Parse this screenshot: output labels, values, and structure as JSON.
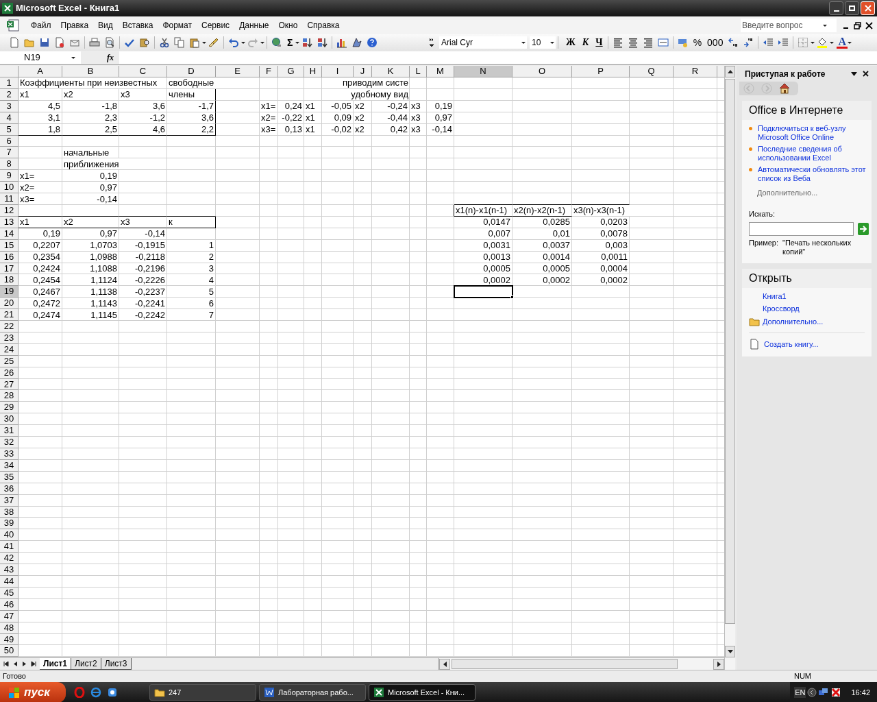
{
  "window": {
    "title": "Microsoft Excel - Книга1"
  },
  "menu": [
    "Файл",
    "Правка",
    "Вид",
    "Вставка",
    "Формат",
    "Сервис",
    "Данные",
    "Окно",
    "Справка"
  ],
  "help_search": {
    "placeholder": "Введите вопрос"
  },
  "toolbar": {
    "autosum": "Σ",
    "font": "Arial Cyr",
    "font_size": "10",
    "bold": "Ж",
    "italic": "К",
    "underline": "Ч",
    "percent": "%",
    "thousands": "000",
    "font_color": "A"
  },
  "formula_bar": {
    "name_box": "N19",
    "fx": "fx"
  },
  "sheet": {
    "columns": [
      {
        "label": "A",
        "selected": false
      },
      {
        "label": "B",
        "selected": false
      },
      {
        "label": "C",
        "selected": false
      },
      {
        "label": "D",
        "selected": false
      },
      {
        "label": "E",
        "selected": false
      },
      {
        "label": "F",
        "selected": false
      },
      {
        "label": "G",
        "selected": false
      },
      {
        "label": "H",
        "selected": false
      },
      {
        "label": "I",
        "selected": false
      },
      {
        "label": "J",
        "selected": false
      },
      {
        "label": "K",
        "selected": false
      },
      {
        "label": "L",
        "selected": false
      },
      {
        "label": "M",
        "selected": false
      },
      {
        "label": "N",
        "selected": true
      },
      {
        "label": "O",
        "selected": false
      },
      {
        "label": "P",
        "selected": false
      },
      {
        "label": "Q",
        "selected": false
      },
      {
        "label": "R",
        "selected": false
      }
    ],
    "rows": [
      {
        "header": "1",
        "selected": false,
        "cells": [
          {
            "text": "Коэффициенты при неизвестных",
            "kind": "text"
          },
          null,
          null,
          {
            "text": "свободные",
            "kind": "text"
          },
          null,
          null,
          null,
          null,
          null,
          null,
          {
            "text": "приводим систе",
            "kind": "clipped"
          }
        ]
      },
      {
        "header": "2",
        "selected": false,
        "cells": [
          {
            "text": "x1",
            "kind": "text"
          },
          {
            "text": "x2",
            "kind": "text"
          },
          {
            "text": "x3",
            "kind": "text"
          },
          {
            "text": "члены",
            "kind": "text"
          },
          null,
          null,
          null,
          null,
          null,
          null,
          {
            "text": "удобному вид",
            "kind": "clipped"
          }
        ]
      },
      {
        "header": "3",
        "selected": false,
        "cells": [
          {
            "text": "4,5",
            "kind": "number"
          },
          {
            "text": "-1,8",
            "kind": "number"
          },
          {
            "text": "3,6",
            "kind": "number"
          },
          {
            "text": "-1,7",
            "kind": "number"
          },
          null,
          {
            "text": "x1=",
            "kind": "text"
          },
          {
            "text": "0,24",
            "kind": "number"
          },
          {
            "text": "x1",
            "kind": "text"
          },
          {
            "text": "-0,05",
            "kind": "number"
          },
          {
            "text": "x2",
            "kind": "text"
          },
          {
            "text": "-0,24",
            "kind": "number"
          },
          {
            "text": "x3",
            "kind": "text"
          },
          {
            "text": "0,19",
            "kind": "number"
          }
        ]
      },
      {
        "header": "4",
        "selected": false,
        "cells": [
          {
            "text": "3,1",
            "kind": "number"
          },
          {
            "text": "2,3",
            "kind": "number"
          },
          {
            "text": "-1,2",
            "kind": "number"
          },
          {
            "text": "3,6",
            "kind": "number"
          },
          null,
          {
            "text": "x2=",
            "kind": "text"
          },
          {
            "text": "-0,22",
            "kind": "number"
          },
          {
            "text": "x1",
            "kind": "text"
          },
          {
            "text": "0,09",
            "kind": "number"
          },
          {
            "text": "x2",
            "kind": "text"
          },
          {
            "text": "-0,44",
            "kind": "number"
          },
          {
            "text": "x3",
            "kind": "text"
          },
          {
            "text": "0,97",
            "kind": "number"
          }
        ]
      },
      {
        "header": "5",
        "selected": false,
        "cells": [
          {
            "text": "1,8",
            "kind": "number"
          },
          {
            "text": "2,5",
            "kind": "number"
          },
          {
            "text": "4,6",
            "kind": "number"
          },
          {
            "text": "2,2",
            "kind": "number"
          },
          null,
          {
            "text": "x3=",
            "kind": "text"
          },
          {
            "text": "0,13",
            "kind": "number"
          },
          {
            "text": "x1",
            "kind": "text"
          },
          {
            "text": "-0,02",
            "kind": "number"
          },
          {
            "text": "x2",
            "kind": "text"
          },
          {
            "text": "0,42",
            "kind": "number"
          },
          {
            "text": "x3",
            "kind": "text"
          },
          {
            "text": "-0,14",
            "kind": "number"
          }
        ]
      },
      {
        "header": "6",
        "selected": false
      },
      {
        "header": "7",
        "selected": false,
        "cells": [
          null,
          {
            "text": "начальные",
            "kind": "text"
          }
        ]
      },
      {
        "header": "8",
        "selected": false,
        "cells": [
          null,
          {
            "text": "приближения",
            "kind": "text"
          }
        ]
      },
      {
        "header": "9",
        "selected": false,
        "cells": [
          {
            "text": "x1=",
            "kind": "text"
          },
          {
            "text": "0,19",
            "kind": "number"
          }
        ]
      },
      {
        "header": "10",
        "selected": false,
        "cells": [
          {
            "text": "x2=",
            "kind": "text"
          },
          {
            "text": "0,97",
            "kind": "number"
          }
        ]
      },
      {
        "header": "11",
        "selected": false,
        "cells": [
          {
            "text": "x3=",
            "kind": "text"
          },
          {
            "text": "-0,14",
            "kind": "number"
          }
        ]
      },
      {
        "header": "12",
        "selected": false,
        "cells": [
          null,
          null,
          null,
          null,
          null,
          null,
          null,
          null,
          null,
          null,
          null,
          null,
          null,
          {
            "text": "x1(n)-x1(n-1)",
            "kind": "text"
          },
          {
            "text": "x2(n)-x2(n-1)",
            "kind": "text"
          },
          {
            "text": "x3(n)-x3(n-1)",
            "kind": "text"
          }
        ]
      },
      {
        "header": "13",
        "selected": false,
        "cells": [
          {
            "text": "x1",
            "kind": "text"
          },
          {
            "text": "x2",
            "kind": "text"
          },
          {
            "text": "x3",
            "kind": "text"
          },
          {
            "text": "к",
            "kind": "text"
          },
          null,
          null,
          null,
          null,
          null,
          null,
          null,
          null,
          null,
          {
            "text": "0,0147",
            "kind": "number"
          },
          {
            "text": "0,0285",
            "kind": "number"
          },
          {
            "text": "0,0203",
            "kind": "number"
          }
        ]
      },
      {
        "header": "14",
        "selected": false,
        "cells": [
          {
            "text": "0,19",
            "kind": "number"
          },
          {
            "text": "0,97",
            "kind": "number"
          },
          {
            "text": "-0,14",
            "kind": "number"
          },
          null,
          null,
          null,
          null,
          null,
          null,
          null,
          null,
          null,
          null,
          {
            "text": "0,007",
            "kind": "number"
          },
          {
            "text": "0,01",
            "kind": "number"
          },
          {
            "text": "0,0078",
            "kind": "number"
          }
        ]
      },
      {
        "header": "15",
        "selected": false,
        "cells": [
          {
            "text": "0,2207",
            "kind": "number"
          },
          {
            "text": "1,0703",
            "kind": "number"
          },
          {
            "text": "-0,1915",
            "kind": "number"
          },
          {
            "text": "1",
            "kind": "number"
          },
          null,
          null,
          null,
          null,
          null,
          null,
          null,
          null,
          null,
          {
            "text": "0,0031",
            "kind": "number"
          },
          {
            "text": "0,0037",
            "kind": "number"
          },
          {
            "text": "0,003",
            "kind": "number"
          }
        ]
      },
      {
        "header": "16",
        "selected": false,
        "cells": [
          {
            "text": "0,2354",
            "kind": "number"
          },
          {
            "text": "1,0988",
            "kind": "number"
          },
          {
            "text": "-0,2118",
            "kind": "number"
          },
          {
            "text": "2",
            "kind": "number"
          },
          null,
          null,
          null,
          null,
          null,
          null,
          null,
          null,
          null,
          {
            "text": "0,0013",
            "kind": "number"
          },
          {
            "text": "0,0014",
            "kind": "number"
          },
          {
            "text": "0,0011",
            "kind": "number"
          }
        ]
      },
      {
        "header": "17",
        "selected": false,
        "cells": [
          {
            "text": "0,2424",
            "kind": "number"
          },
          {
            "text": "1,1088",
            "kind": "number"
          },
          {
            "text": "-0,2196",
            "kind": "number"
          },
          {
            "text": "3",
            "kind": "number"
          },
          null,
          null,
          null,
          null,
          null,
          null,
          null,
          null,
          null,
          {
            "text": "0,0005",
            "kind": "number"
          },
          {
            "text": "0,0005",
            "kind": "number"
          },
          {
            "text": "0,0004",
            "kind": "number"
          }
        ]
      },
      {
        "header": "18",
        "selected": false,
        "cells": [
          {
            "text": "0,2454",
            "kind": "number"
          },
          {
            "text": "1,1124",
            "kind": "number"
          },
          {
            "text": "-0,2226",
            "kind": "number"
          },
          {
            "text": "4",
            "kind": "number"
          },
          null,
          null,
          null,
          null,
          null,
          null,
          null,
          null,
          null,
          {
            "text": "0,0002",
            "kind": "number"
          },
          {
            "text": "0,0002",
            "kind": "number"
          },
          {
            "text": "0,0002",
            "kind": "number"
          }
        ]
      },
      {
        "header": "19",
        "selected": true,
        "cells": [
          {
            "text": "0,2467",
            "kind": "number"
          },
          {
            "text": "1,1138",
            "kind": "number"
          },
          {
            "text": "-0,2237",
            "kind": "number"
          },
          {
            "text": "5",
            "kind": "number"
          }
        ]
      },
      {
        "header": "20",
        "selected": false,
        "cells": [
          {
            "text": "0,2472",
            "kind": "number"
          },
          {
            "text": "1,1143",
            "kind": "number"
          },
          {
            "text": "-0,2241",
            "kind": "number"
          },
          {
            "text": "6",
            "kind": "number"
          }
        ]
      },
      {
        "header": "21",
        "selected": false,
        "cells": [
          {
            "text": "0,2474",
            "kind": "number"
          },
          {
            "text": "1,1145",
            "kind": "number"
          },
          {
            "text": "-0,2242",
            "kind": "number"
          },
          {
            "text": "7",
            "kind": "number"
          }
        ]
      },
      {
        "header": "22",
        "selected": false
      },
      {
        "header": "23",
        "selected": false
      },
      {
        "header": "24",
        "selected": false
      },
      {
        "header": "25",
        "selected": false
      },
      {
        "header": "26",
        "selected": false
      },
      {
        "header": "27",
        "selected": false
      },
      {
        "header": "28",
        "selected": false
      },
      {
        "header": "29",
        "selected": false
      },
      {
        "header": "30",
        "selected": false
      },
      {
        "header": "31",
        "selected": false
      },
      {
        "header": "32",
        "selected": false
      },
      {
        "header": "33",
        "selected": false
      },
      {
        "header": "34",
        "selected": false
      },
      {
        "header": "35",
        "selected": false
      },
      {
        "header": "36",
        "selected": false
      },
      {
        "header": "37",
        "selected": false
      },
      {
        "header": "38",
        "selected": false
      },
      {
        "header": "39",
        "selected": false
      },
      {
        "header": "40",
        "selected": false
      },
      {
        "header": "41",
        "selected": false
      },
      {
        "header": "42",
        "selected": false
      },
      {
        "header": "43",
        "selected": false
      },
      {
        "header": "44",
        "selected": false
      },
      {
        "header": "45",
        "selected": false
      },
      {
        "header": "46",
        "selected": false
      },
      {
        "header": "47",
        "selected": false
      },
      {
        "header": "48",
        "selected": false
      },
      {
        "header": "49",
        "selected": false
      },
      {
        "header": "50",
        "selected": false
      }
    ]
  },
  "sheet_tabs": [
    {
      "label": "Лист1",
      "selected": true
    },
    {
      "label": "Лист2",
      "selected": false
    },
    {
      "label": "Лист3",
      "selected": false
    }
  ],
  "task_pane": {
    "title": "Приступая к работе",
    "online": {
      "heading": "Office в Интернете",
      "links": [
        "Подключиться к веб-узлу Microsoft Office Online",
        "Последние сведения об использовании Excel",
        "Автоматически обновлять этот список из Веба"
      ],
      "more": "Дополнительно...",
      "search_label": "Искать:",
      "example_label": "Пример:",
      "example": "\"Печать нескольких копий\""
    },
    "open": {
      "heading": "Открыть",
      "files": [
        "Книга1",
        "Кроссворд"
      ],
      "more": "Дополнительно...",
      "create": "Создать книгу..."
    }
  },
  "status_bar": {
    "text": "Готово",
    "num": "NUM"
  },
  "taskbar": {
    "start": "пуск",
    "tasks": [
      {
        "label": "247",
        "selected": false
      },
      {
        "label": "Лабораторная рабо...",
        "selected": false
      },
      {
        "label": "Microsoft Excel - Кни...",
        "selected": true
      }
    ],
    "language": "EN",
    "clock": "16:42"
  }
}
